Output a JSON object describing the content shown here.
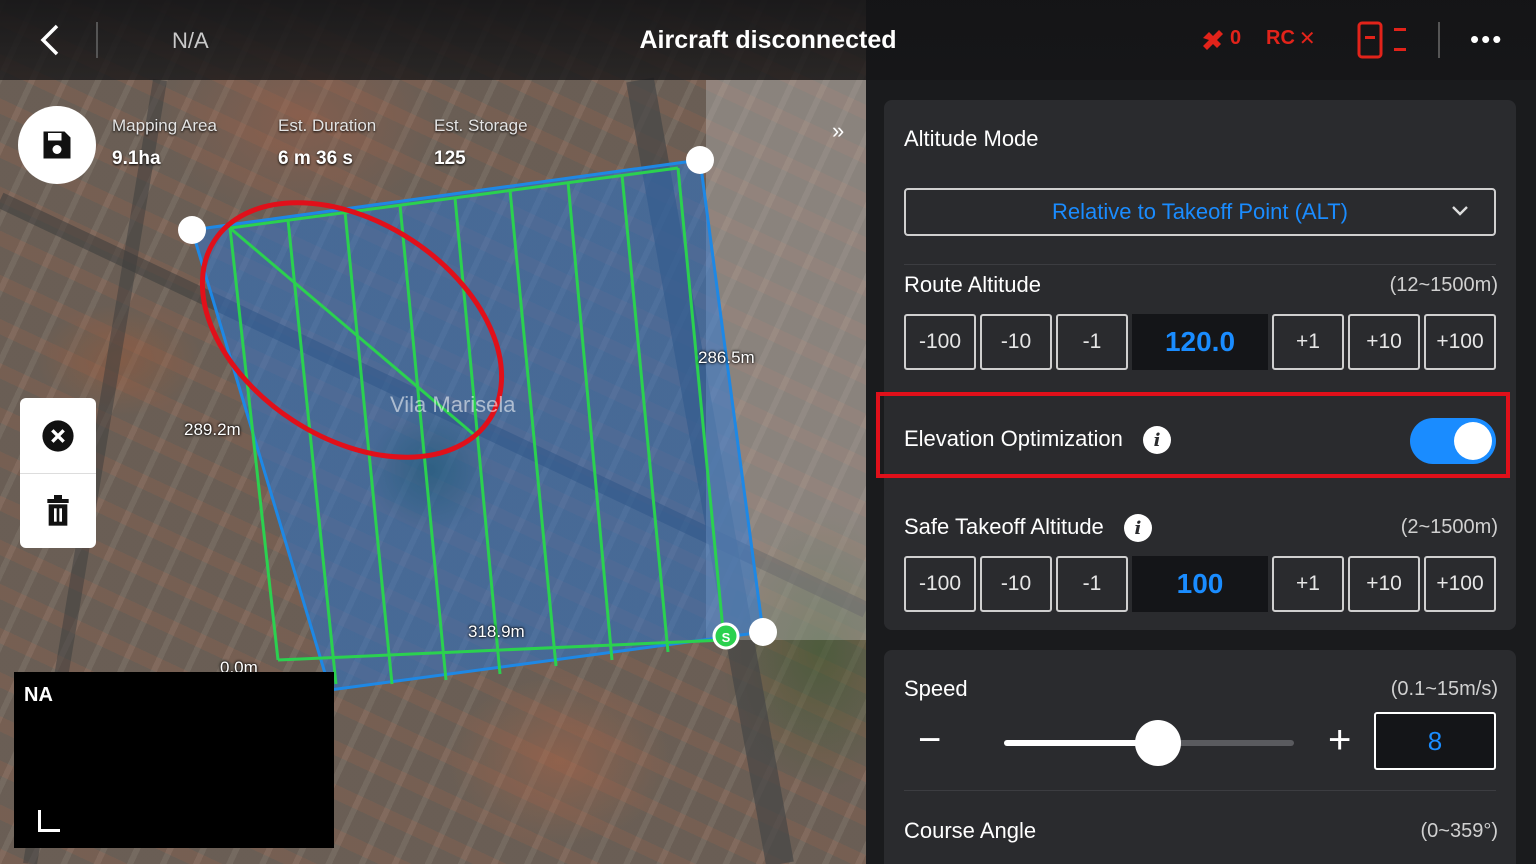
{
  "topbar": {
    "back_icon": "chevron-left-icon",
    "status_na": "N/A",
    "title": "Aircraft disconnected",
    "drone_signal": "0",
    "rc_label": "RC",
    "more_icon": "ellipsis-icon"
  },
  "map": {
    "stats": [
      {
        "label": "Mapping Area",
        "value": "9.1ha"
      },
      {
        "label": "Est. Duration",
        "value": "6 m 36 s"
      },
      {
        "label": "Est. Storage",
        "value": "125"
      }
    ],
    "distances": {
      "left": "289.2m",
      "right": "286.5m",
      "bottom": "318.9m",
      "corner": "0.0m"
    },
    "place_label": "Vila Marisela",
    "start_marker": "S",
    "camera_label": "NA",
    "colors": {
      "route": "#2bd14f",
      "area": "#1e88e5",
      "highlight": "#e0101a"
    }
  },
  "panel": {
    "altitude_mode": {
      "label": "Altitude Mode",
      "value": "Relative to Takeoff Point (ALT)"
    },
    "route_altitude": {
      "label": "Route Altitude",
      "range": "(12~1500m)",
      "buttons": [
        "-100",
        "-10",
        "-1",
        "+1",
        "+10",
        "+100"
      ],
      "value": "120.0"
    },
    "elevation_optimization": {
      "label": "Elevation Optimization",
      "enabled": true
    },
    "safe_takeoff_altitude": {
      "label": "Safe Takeoff Altitude",
      "range": "(2~1500m)",
      "buttons": [
        "-100",
        "-10",
        "-1",
        "+1",
        "+10",
        "+100"
      ],
      "value": "100"
    },
    "speed": {
      "label": "Speed",
      "range": "(0.1~15m/s)",
      "value": "8",
      "fraction": 0.53
    },
    "course_angle": {
      "label": "Course Angle",
      "range": "(0~359°)"
    }
  }
}
